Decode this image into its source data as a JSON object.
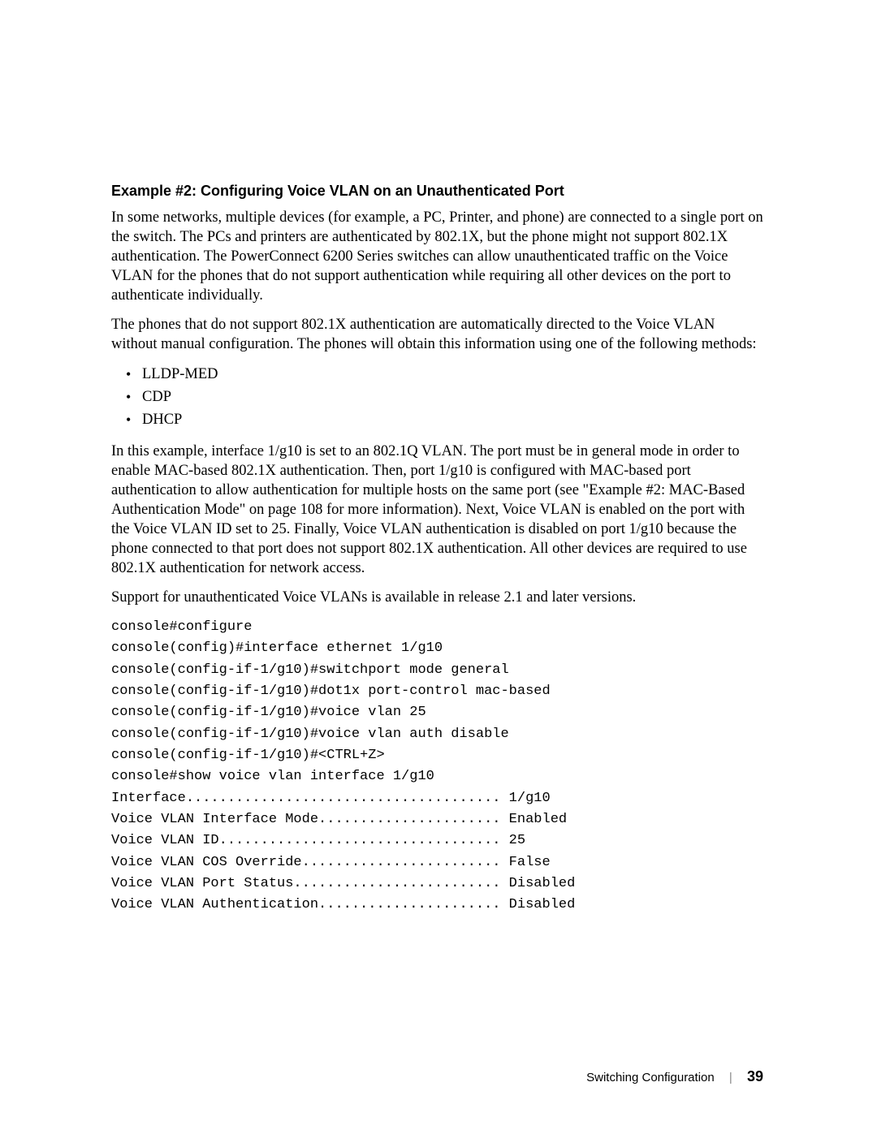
{
  "heading": "Example #2: Configuring Voice VLAN on an Unauthenticated Port",
  "para1": "In some networks, multiple devices (for example, a PC, Printer, and phone) are connected to a single port on the switch. The PCs and printers are authenticated by 802.1X, but the phone might not support 802.1X authentication. The PowerConnect 6200 Series switches can allow unauthenticated traffic on the Voice VLAN for the phones that do not support authentication while requiring all other devices on the port to authenticate individually.",
  "para2": "The phones that do not support 802.1X authentication are automatically directed to the Voice VLAN without manual configuration. The phones will obtain this information using one of the following methods:",
  "bullets": [
    "LLDP-MED",
    "CDP",
    "DHCP"
  ],
  "para3": "In this example, interface 1/g10 is set to an 802.1Q VLAN. The port must be in general mode in order to enable MAC-based 802.1X authentication. Then, port 1/g10 is configured with MAC-based port authentication to allow authentication for multiple hosts on the same port (see \"Example #2: MAC-Based Authentication Mode\" on page 108 for more information). Next, Voice VLAN is enabled on the port with the Voice VLAN ID set to 25. Finally, Voice VLAN authentication is disabled on port 1/g10 because the phone connected to that port does not support 802.1X authentication. All other devices are required to use 802.1X authentication for network access.",
  "para4": "Support for unauthenticated Voice VLANs is available in release 2.1 and later versions.",
  "cli": {
    "l1": "console#configure",
    "l2": "console(config)#interface ethernet 1/g10",
    "l3": "",
    "l4": "console(config-if-1/g10)#switchport mode general",
    "l5": "console(config-if-1/g10)#dot1x port-control mac-based",
    "l6": "console(config-if-1/g10)#voice vlan 25",
    "l7": "console(config-if-1/g10)#voice vlan auth disable",
    "l8": "console(config-if-1/g10)#<CTRL+Z>",
    "l9": "console#show voice vlan interface 1/g10",
    "l10": "",
    "l11": "Interface...................................... 1/g10",
    "l12": "Voice VLAN Interface Mode...................... Enabled",
    "l13": "Voice VLAN ID.................................. 25",
    "l14": "Voice VLAN COS Override........................ False",
    "l15": "Voice VLAN Port Status......................... Disabled",
    "l16": "Voice VLAN Authentication...................... Disabled"
  },
  "footer": {
    "section": "Switching Configuration",
    "page": "39"
  }
}
